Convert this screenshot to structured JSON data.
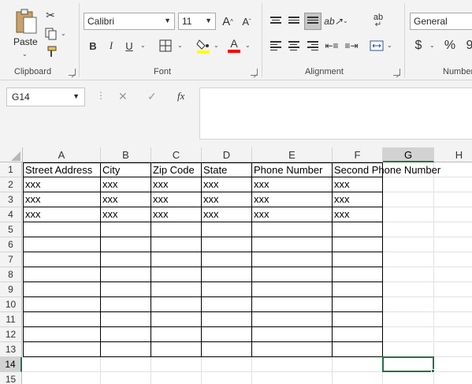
{
  "ribbon": {
    "groups": {
      "clipboard": "Clipboard",
      "font": "Font",
      "alignment": "Alignment",
      "number": "Number"
    },
    "paste_label": "Paste",
    "font_name": "Calibri",
    "font_size": "11",
    "number_format": "General",
    "grow_font": "A",
    "shrink_font": "A",
    "bold": "B",
    "italic": "I",
    "underline": "U",
    "font_color_letter": "A",
    "wrap_text": "ab",
    "currency": "$",
    "percent": "%"
  },
  "formula_bar": {
    "name_box": "G14",
    "formula": ""
  },
  "icons": {
    "cut": "cut-icon",
    "copy": "copy-icon",
    "format_painter": "format-painter-icon",
    "fx": "fx-icon",
    "cancel": "cancel-icon",
    "enter": "enter-icon"
  },
  "fx_label": "fx",
  "sheet": {
    "columns": [
      "A",
      "B",
      "C",
      "D",
      "E",
      "F",
      "G",
      "H"
    ],
    "rows": [
      "1",
      "2",
      "3",
      "4",
      "5",
      "6",
      "7",
      "8",
      "9",
      "10",
      "11",
      "12",
      "13",
      "14",
      "15"
    ],
    "active_cell": "G14",
    "headers": [
      "Street Address",
      "City",
      "Zip Code",
      "State",
      "Phone Number",
      "Second Phone Number"
    ],
    "data": [
      [
        "xxx",
        "xxx",
        "xxx",
        "xxx",
        "xxx",
        "xxx"
      ],
      [
        "xxx",
        "xxx",
        "xxx",
        "xxx",
        "xxx",
        "xxx"
      ],
      [
        "xxx",
        "xxx",
        "xxx",
        "xxx",
        "xxx",
        "xxx"
      ]
    ]
  },
  "colors": {
    "accent": "#217346",
    "highlight_yellow": "#ffff00",
    "font_red": "#ff0000"
  }
}
